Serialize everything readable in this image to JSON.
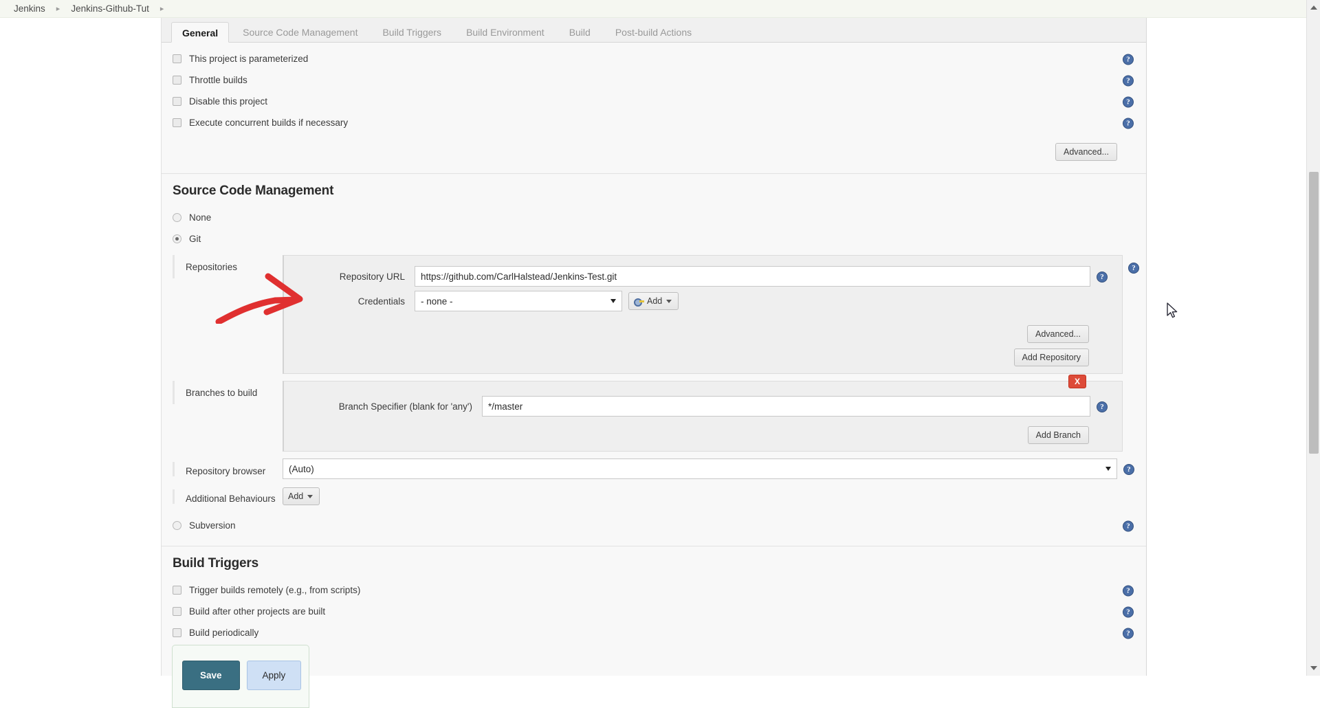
{
  "breadcrumb": {
    "items": [
      {
        "label": "Jenkins"
      },
      {
        "label": "Jenkins-Github-Tut"
      }
    ],
    "separator": "▸"
  },
  "tabs": [
    {
      "label": "General",
      "active": true
    },
    {
      "label": "Source Code Management",
      "active": false
    },
    {
      "label": "Build Triggers",
      "active": false
    },
    {
      "label": "Build Environment",
      "active": false
    },
    {
      "label": "Build",
      "active": false
    },
    {
      "label": "Post-build Actions",
      "active": false
    }
  ],
  "general": {
    "checkboxes": [
      {
        "label": "This project is parameterized",
        "checked": false
      },
      {
        "label": "Throttle builds",
        "checked": false
      },
      {
        "label": "Disable this project",
        "checked": false
      },
      {
        "label": "Execute concurrent builds if necessary",
        "checked": false
      }
    ],
    "advanced_label": "Advanced..."
  },
  "scm": {
    "title": "Source Code Management",
    "options": [
      {
        "label": "None",
        "selected": false
      },
      {
        "label": "Git",
        "selected": true
      },
      {
        "label": "Subversion",
        "selected": false
      }
    ],
    "repositories": {
      "label": "Repositories",
      "repository_url_label": "Repository URL",
      "repository_url_value": "https://github.com/CarlHalstead/Jenkins-Test.git",
      "credentials_label": "Credentials",
      "credentials_value": "- none -",
      "add_credentials_label": "Add",
      "advanced_label": "Advanced...",
      "add_repository_label": "Add Repository"
    },
    "branches": {
      "label": "Branches to build",
      "branch_specifier_label": "Branch Specifier (blank for 'any')",
      "branch_specifier_value": "*/master",
      "delete_label": "X",
      "add_branch_label": "Add Branch"
    },
    "repository_browser": {
      "label": "Repository browser",
      "value": "(Auto)"
    },
    "additional_behaviours": {
      "label": "Additional Behaviours",
      "add_label": "Add"
    }
  },
  "build_triggers": {
    "title": "Build Triggers",
    "checkboxes": [
      {
        "label": "Trigger builds remotely (e.g., from scripts)",
        "checked": false
      },
      {
        "label": "Build after other projects are built",
        "checked": false
      },
      {
        "label": "Build periodically",
        "checked": false
      }
    ]
  },
  "footer": {
    "save_label": "Save",
    "apply_label": "Apply"
  },
  "icons": {
    "help": "?"
  },
  "colors": {
    "accent": "#3a6f82",
    "apply": "#cfe0f5",
    "danger": "#dd4b39",
    "help": "#4b6fa8",
    "annotation": "#e03030"
  }
}
